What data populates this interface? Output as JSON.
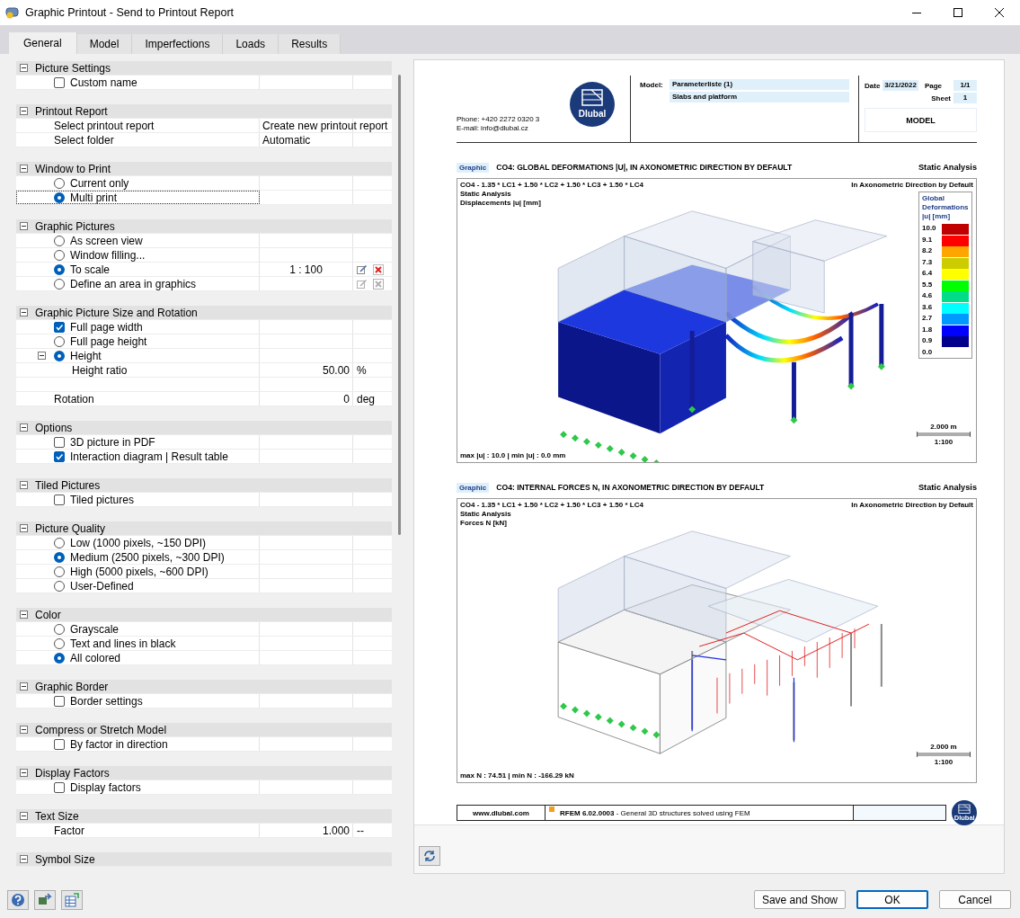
{
  "window": {
    "title": "Graphic Printout - Send to Printout Report"
  },
  "tabs": [
    {
      "label": "General",
      "selected": true
    },
    {
      "label": "Model",
      "selected": false
    },
    {
      "label": "Imperfections",
      "selected": false
    },
    {
      "label": "Loads",
      "selected": false
    },
    {
      "label": "Results",
      "selected": false
    }
  ],
  "sections": [
    {
      "title": "Picture Settings",
      "expanded": true,
      "rows": [
        {
          "kind": "checkbox",
          "label": "Custom name",
          "checked": false
        }
      ]
    },
    {
      "title": "Printout Report",
      "expanded": true,
      "rows": [
        {
          "kind": "text",
          "label": "Select printout report",
          "value": "Create new printout report"
        },
        {
          "kind": "text",
          "label": "Select folder",
          "value": "Automatic"
        }
      ]
    },
    {
      "title": "Window to Print",
      "expanded": true,
      "rows": [
        {
          "kind": "radio",
          "label": "Current only",
          "selected": false,
          "focused": false
        },
        {
          "kind": "radio",
          "label": "Multi print",
          "selected": true,
          "focused": true
        }
      ]
    },
    {
      "title": "Graphic Pictures",
      "expanded": true,
      "rows": [
        {
          "kind": "radio",
          "label": "As screen view",
          "selected": false
        },
        {
          "kind": "radio",
          "label": "Window filling...",
          "selected": false
        },
        {
          "kind": "radio",
          "label": "To scale",
          "selected": true,
          "value": "1 : 100",
          "actions": [
            {
              "kind": "edit",
              "disabled": false
            },
            {
              "kind": "delete",
              "disabled": false
            }
          ]
        },
        {
          "kind": "radio",
          "label": "Define an area in graphics",
          "selected": false,
          "actions": [
            {
              "kind": "edit",
              "disabled": true
            },
            {
              "kind": "delete",
              "disabled": true
            }
          ]
        }
      ]
    },
    {
      "title": "Graphic Picture Size and Rotation",
      "expanded": true,
      "rows": [
        {
          "kind": "checkbox",
          "label": "Full page width",
          "checked": true
        },
        {
          "kind": "radio",
          "label": "Full page height",
          "selected": false
        },
        {
          "kind": "radio",
          "label": "Height",
          "selected": true,
          "expanded": true,
          "children": [
            {
              "kind": "text",
              "label": "Height ratio",
              "value": "50.00",
              "unit": "%"
            }
          ]
        },
        {
          "kind": "blank"
        },
        {
          "kind": "text",
          "label": "Rotation",
          "value": "0",
          "unit": "deg"
        }
      ]
    },
    {
      "title": "Options",
      "expanded": true,
      "rows": [
        {
          "kind": "checkbox",
          "label": "3D picture in PDF",
          "checked": false
        },
        {
          "kind": "checkbox",
          "label": "Interaction diagram | Result table",
          "checked": true
        }
      ]
    },
    {
      "title": "Tiled Pictures",
      "expanded": true,
      "rows": [
        {
          "kind": "checkbox",
          "label": "Tiled pictures",
          "checked": false
        }
      ]
    },
    {
      "title": "Picture Quality",
      "expanded": true,
      "rows": [
        {
          "kind": "radio",
          "label": "Low (1000 pixels, ~150 DPI)",
          "selected": false
        },
        {
          "kind": "radio",
          "label": "Medium (2500 pixels, ~300 DPI)",
          "selected": true
        },
        {
          "kind": "radio",
          "label": "High (5000 pixels, ~600 DPI)",
          "selected": false
        },
        {
          "kind": "radio",
          "label": "User-Defined",
          "selected": false
        }
      ]
    },
    {
      "title": "Color",
      "expanded": true,
      "rows": [
        {
          "kind": "radio",
          "label": "Grayscale",
          "selected": false
        },
        {
          "kind": "radio",
          "label": "Text and lines in black",
          "selected": false
        },
        {
          "kind": "radio",
          "label": "All colored",
          "selected": true
        }
      ]
    },
    {
      "title": "Graphic Border",
      "expanded": true,
      "rows": [
        {
          "kind": "checkbox",
          "label": "Border settings",
          "checked": false
        }
      ]
    },
    {
      "title": "Compress or Stretch Model",
      "expanded": true,
      "rows": [
        {
          "kind": "checkbox",
          "label": "By factor in direction",
          "checked": false
        }
      ]
    },
    {
      "title": "Display Factors",
      "expanded": true,
      "rows": [
        {
          "kind": "checkbox",
          "label": "Display factors",
          "checked": false
        }
      ]
    },
    {
      "title": "Text Size",
      "expanded": true,
      "rows": [
        {
          "kind": "text",
          "label": "Factor",
          "value": "1.000",
          "unit": "--"
        }
      ]
    },
    {
      "title": "Symbol Size",
      "expanded": true
    }
  ],
  "preview": {
    "header": {
      "phone": "Phone: +420 2272 0320 3",
      "email": "E-mail: info@dlubal.cz",
      "logo_text": "Dlubal",
      "model_label": "Model:",
      "model_fields": [
        "Parameterliste (1)",
        "Slabs and platform"
      ],
      "date_label": "Date",
      "date": "3/21/2022",
      "page_label": "Page",
      "page": "1/1",
      "sheet_label": "Sheet",
      "sheet": "1",
      "chapter": "MODEL"
    },
    "graphics": [
      {
        "kind": "deformation",
        "badge": "Graphic",
        "title": "CO4: GLOBAL DEFORMATIONS |U|, IN AXONOMETRIC DIRECTION BY DEFAULT",
        "analysis": "Static Analysis",
        "info_lines": [
          "CO4 - 1.35 * LC1 + 1.50 * LC2 + 1.50 * LC3 + 1.50 * LC4",
          "Static Analysis",
          "Displacements |u| [mm]"
        ],
        "direction": "In Axonometric Direction by Default",
        "legend": {
          "title_lines": [
            "Global",
            "Deformations",
            "|u| [mm]"
          ],
          "steps": [
            {
              "value": "10.0",
              "color": "#c00000"
            },
            {
              "value": "9.1",
              "color": "#ff0000"
            },
            {
              "value": "8.2",
              "color": "#ffa500"
            },
            {
              "value": "7.3",
              "color": "#cccc00"
            },
            {
              "value": "6.4",
              "color": "#ffff00"
            },
            {
              "value": "5.5",
              "color": "#00ff00"
            },
            {
              "value": "4.6",
              "color": "#00dd88"
            },
            {
              "value": "3.6",
              "color": "#00ffff"
            },
            {
              "value": "2.7",
              "color": "#0099ff"
            },
            {
              "value": "1.8",
              "color": "#0000ff"
            },
            {
              "value": "0.9",
              "color": "#00008b"
            }
          ],
          "bottom_value": "0.0"
        },
        "summary": "max |u| : 10.0 | min |u| : 0.0 mm",
        "scale_length": "2.000 m",
        "scale_ratio": "1:100"
      },
      {
        "kind": "forces",
        "badge": "Graphic",
        "title": "CO4: INTERNAL FORCES N, IN AXONOMETRIC DIRECTION BY DEFAULT",
        "analysis": "Static Analysis",
        "info_lines": [
          "CO4 - 1.35 * LC1 + 1.50 * LC2 + 1.50 * LC3 + 1.50 * LC4",
          "Static Analysis",
          "Forces N [kN]"
        ],
        "direction": "In Axonometric Direction by Default",
        "summary": "max N : 74.51 | min N : -166.29 kN",
        "scale_length": "2.000 m",
        "scale_ratio": "1:100"
      }
    ],
    "footer": {
      "website": "www.dlubal.com",
      "product": "**RFEM 6.02.0003** - General 3D structures solved using FEM",
      "logo_text": "Dlubal"
    }
  },
  "buttons": [
    {
      "label": "Save and Show",
      "default": false
    },
    {
      "label": "OK",
      "default": true
    },
    {
      "label": "Cancel",
      "default": false
    }
  ]
}
